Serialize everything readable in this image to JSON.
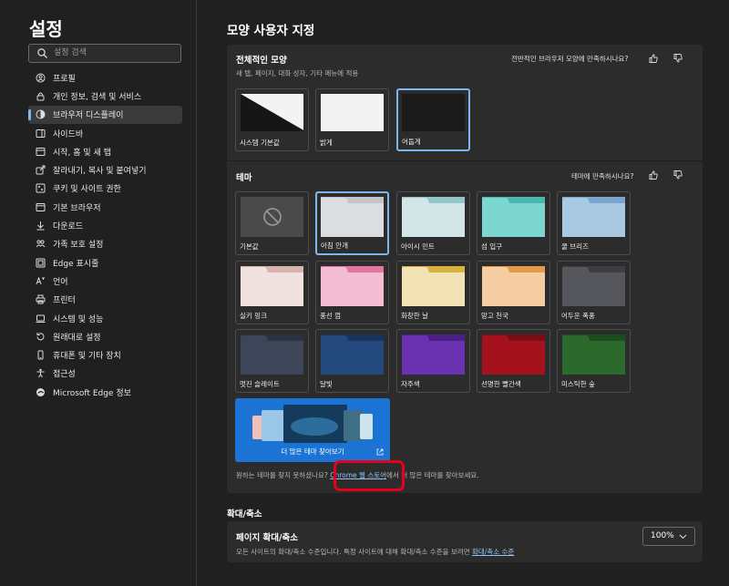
{
  "sidebar": {
    "title": "설정",
    "search_placeholder": "설정 검색",
    "items": [
      {
        "label": "프로필",
        "icon": "profile-icon"
      },
      {
        "label": "개인 정보, 검색 및 서비스",
        "icon": "lock-icon"
      },
      {
        "label": "브라우저 디스플레이",
        "icon": "appearance-icon",
        "active": true
      },
      {
        "label": "사이드바",
        "icon": "sidebar-icon"
      },
      {
        "label": "시작, 홈 및 새 탭",
        "icon": "home-icon"
      },
      {
        "label": "잘라내기, 복사 및 붙여넣기",
        "icon": "share-icon"
      },
      {
        "label": "쿠키 및 사이트 권한",
        "icon": "cookie-icon"
      },
      {
        "label": "기본 브라우저",
        "icon": "browser-icon"
      },
      {
        "label": "다운로드",
        "icon": "download-icon"
      },
      {
        "label": "가족 보호 설정",
        "icon": "family-icon"
      },
      {
        "label": "Edge 표시줄",
        "icon": "edge-bar-icon"
      },
      {
        "label": "언어",
        "icon": "language-icon"
      },
      {
        "label": "프린터",
        "icon": "printer-icon"
      },
      {
        "label": "시스템 및 성능",
        "icon": "system-icon"
      },
      {
        "label": "원래대로 설정",
        "icon": "reset-icon"
      },
      {
        "label": "휴대폰 및 기타 장치",
        "icon": "phone-icon"
      },
      {
        "label": "접근성",
        "icon": "accessibility-icon"
      },
      {
        "label": "Microsoft Edge 정보",
        "icon": "edge-logo-icon"
      }
    ]
  },
  "main": {
    "title": "모양 사용자 지정",
    "appearance": {
      "title": "전체적인 모양",
      "subtitle": "새 탭, 페이지, 대화 상자, 기타 메뉴에 적용",
      "feedback": "전반적인 브라우저 모양에 만족하시나요?",
      "options": [
        {
          "label": "시스템 기본값",
          "selected": false
        },
        {
          "label": "밝게",
          "selected": false
        },
        {
          "label": "어둡게",
          "selected": true
        }
      ]
    },
    "themes": {
      "title": "테마",
      "feedback": "테마에 만족하시나요?",
      "items": [
        {
          "label": "기본값",
          "color": "#4a4a4a",
          "tab": "#4a4a4a",
          "selected": false
        },
        {
          "label": "아침 안개",
          "color": "#dcdde0",
          "tab": "#c4c5c9",
          "selected": true
        },
        {
          "label": "아이시 민트",
          "color": "#d2e6e8",
          "tab": "#93c5c8",
          "selected": false
        },
        {
          "label": "섬 입구",
          "color": "#7ed6d0",
          "tab": "#48b8b1",
          "selected": false
        },
        {
          "label": "쿨 브리즈",
          "color": "#a9c8e2",
          "tab": "#7aa6cd",
          "selected": false
        },
        {
          "label": "실키 핑크",
          "color": "#f1e1df",
          "tab": "#d9b4ae",
          "selected": false
        },
        {
          "label": "풍선 껌",
          "color": "#f4bcd3",
          "tab": "#e2759f",
          "selected": false
        },
        {
          "label": "화창한 날",
          "color": "#f2e2b6",
          "tab": "#d9b23e",
          "selected": false
        },
        {
          "label": "망고 천국",
          "color": "#f5cda2",
          "tab": "#e39a4d",
          "selected": false
        },
        {
          "label": "어두운 폭풍",
          "color": "#55575c",
          "tab": "#3c3e43",
          "selected": false
        },
        {
          "label": "멋진 슬레이트",
          "color": "#3d4659",
          "tab": "#2a3244",
          "selected": false
        },
        {
          "label": "달빛",
          "color": "#244a7d",
          "tab": "#1a355c",
          "selected": false
        },
        {
          "label": "자주색",
          "color": "#6a32b0",
          "tab": "#4d1f86",
          "selected": false
        },
        {
          "label": "선명한 빨간색",
          "color": "#a4121d",
          "tab": "#7a0c14",
          "selected": false
        },
        {
          "label": "미스틱한 숲",
          "color": "#2b6a2c",
          "tab": "#1c4d1d",
          "selected": false
        }
      ],
      "more_label": "더 많은 테마 찾아보기",
      "hint_prefix": "원하는 테마를 찾지 못하셨나요?",
      "hint_link": "Chrome 웹 스토어",
      "hint_suffix": "에서 더 많은 테마를 찾아보세요."
    },
    "zoom": {
      "section_title": "확대/축소",
      "title": "페이지 확대/축소",
      "desc": "모든 사이트의 확대/축소 수준입니다. 특정 사이트에 대해 확대/축소 수준을 보려면",
      "link": "확대/축소 수준",
      "value": "100%"
    }
  },
  "colors": {
    "accent": "#7cb8ee",
    "highlight": "#e5001f"
  }
}
